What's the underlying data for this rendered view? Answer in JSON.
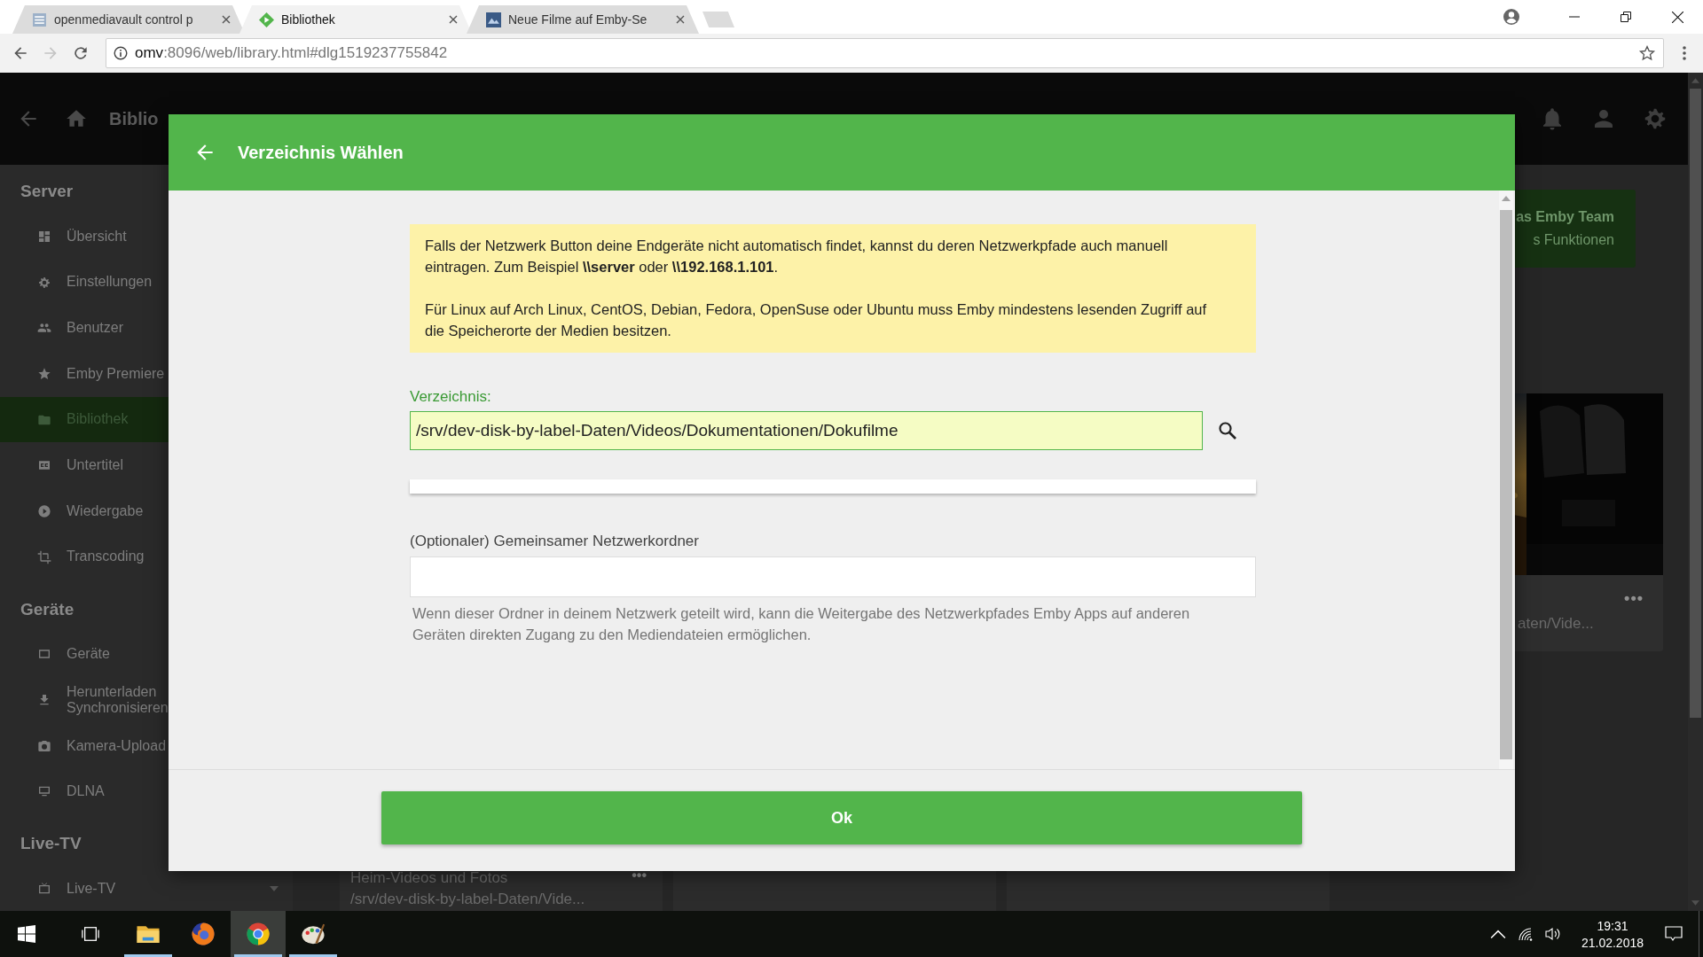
{
  "browser": {
    "tabs": [
      {
        "title": "openmediavault control p",
        "selected": false
      },
      {
        "title": "Bibliothek",
        "selected": true
      },
      {
        "title": "Neue Filme auf Emby-Se",
        "selected": false
      }
    ],
    "address": {
      "host": "omv",
      "path": ":8096/web/library.html#dlg1519237755842"
    }
  },
  "app_header": {
    "title": "Biblio"
  },
  "sidebar": {
    "sections": [
      {
        "title": "Server",
        "items": [
          {
            "label": "Übersicht",
            "selected": false
          },
          {
            "label": "Einstellungen",
            "selected": false
          },
          {
            "label": "Benutzer",
            "selected": false
          },
          {
            "label": "Emby Premiere",
            "selected": false
          },
          {
            "label": "Bibliothek",
            "selected": true
          },
          {
            "label": "Untertitel",
            "selected": false
          },
          {
            "label": "Wiedergabe",
            "selected": false
          },
          {
            "label": "Transcoding",
            "selected": false
          }
        ]
      },
      {
        "title": "Geräte",
        "items": [
          {
            "label": "Geräte",
            "selected": false
          },
          {
            "label": "Herunterladen\nSynchronisieren",
            "selected": false
          },
          {
            "label": "Kamera-Upload",
            "selected": false
          },
          {
            "label": "DLNA",
            "selected": false
          }
        ]
      },
      {
        "title": "Live-TV",
        "items": [
          {
            "label": "Live-TV",
            "selected": false,
            "expandable": true
          }
        ]
      }
    ]
  },
  "promo_card": {
    "lines": [
      "as Emby Team",
      "s Funktionen"
    ]
  },
  "media_card": {
    "kind": "picture",
    "menu": "•••",
    "subtitle": "aten/Vide..."
  },
  "library_cards": [
    {
      "kind": "text",
      "title": "Heim-Videos und Fotos",
      "path": "/srv/dev-disk-by-label-Daten/Vide...",
      "menu": "•••"
    },
    {
      "kind": "empty"
    },
    {
      "kind": "empty"
    }
  ],
  "dialog": {
    "title": "Verzeichnis Wählen",
    "notice": [
      "Falls der Netzwerk Button deine Endgeräte nicht automatisch findet, kannst du deren Netzwerkpfade auch manuell eintragen. Zum Beispiel **\\\\server** oder **\\\\192.168.1.101**.",
      "Für Linux auf Arch Linux, CentOS, Debian, Fedora, OpenSuse oder Ubuntu muss Emby mindestens lesenden Zugriff auf die Speicherorte der Medien besitzen."
    ],
    "path_field": {
      "label": "Verzeichnis:",
      "value": "/srv/dev-disk-by-label-Daten/Videos/Dokumentationen/Dokufilme",
      "focused": true
    },
    "share_field": {
      "label": "(Optionaler) Gemeinsamer Netzwerkordner",
      "help": "Wenn dieser Ordner in deinem Netzwerk geteilt wird, kann die Weitergabe des Netzwerkpfades Emby Apps auf anderen Geräten direkten Zugang zu den Mediendateien ermöglichen."
    },
    "ok_button": "Ok"
  },
  "taskbar": {
    "apps": [
      {
        "kind": "explorer",
        "running": true,
        "active": false
      },
      {
        "kind": "firefox",
        "running": false,
        "active": false
      },
      {
        "kind": "chrome",
        "running": true,
        "active": true
      },
      {
        "kind": "paint",
        "running": true,
        "active": false
      }
    ],
    "clock": {
      "time": "19:31",
      "date": "21.02.2018"
    }
  }
}
